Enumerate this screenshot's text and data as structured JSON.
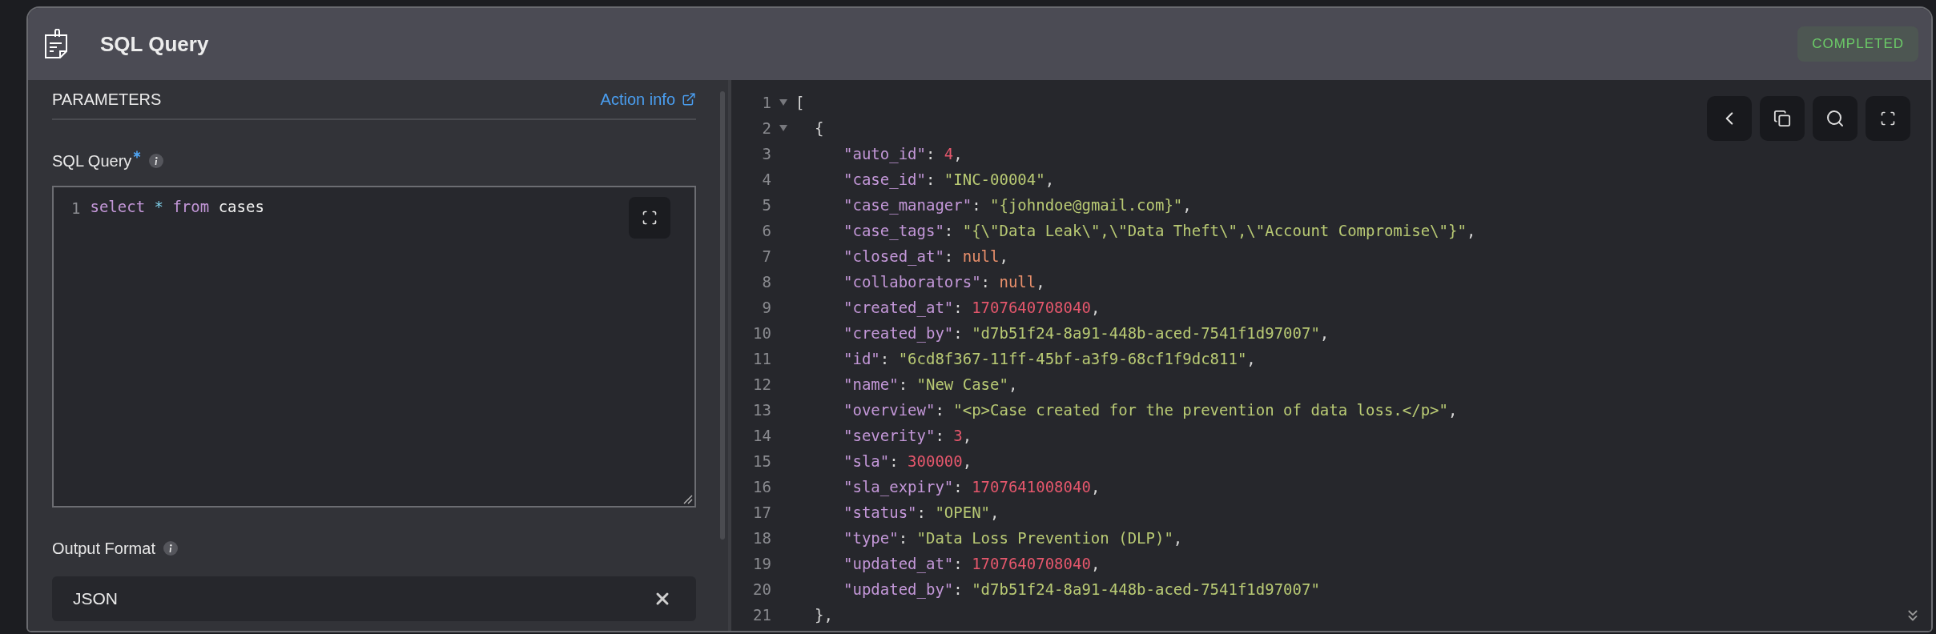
{
  "header": {
    "title": "SQL Query",
    "status": "COMPLETED"
  },
  "parameters": {
    "heading": "PARAMETERS",
    "action_link": "Action info",
    "fields": [
      {
        "kind": "code",
        "label": "SQL Query",
        "required": true,
        "line_number": "1",
        "tokens": [
          {
            "kind": "keyword",
            "text": "select"
          },
          {
            "kind": "operator",
            "text": "*"
          },
          {
            "kind": "keyword",
            "text": "from"
          },
          {
            "kind": "plain",
            "text": "cases"
          }
        ]
      },
      {
        "kind": "select",
        "label": "Output Format",
        "value": "JSON"
      }
    ]
  },
  "output": {
    "lines": [
      {
        "number": "1",
        "foldable": true,
        "tokens": [
          {
            "kind": "punct",
            "text": "["
          }
        ],
        "children": [
          {
            "number": "2",
            "foldable": true,
            "tokens": [
              {
                "kind": "punct",
                "text": "{"
              }
            ],
            "children": [
              {
                "number": "3",
                "tokens": [
                  {
                    "kind": "key",
                    "text": "\"auto_id\""
                  },
                  {
                    "kind": "punct",
                    "text": ": "
                  },
                  {
                    "kind": "number",
                    "text": "4"
                  },
                  {
                    "kind": "punct",
                    "text": ","
                  }
                ]
              },
              {
                "number": "4",
                "tokens": [
                  {
                    "kind": "key",
                    "text": "\"case_id\""
                  },
                  {
                    "kind": "punct",
                    "text": ": "
                  },
                  {
                    "kind": "string",
                    "text": "\"INC-00004\""
                  },
                  {
                    "kind": "punct",
                    "text": ","
                  }
                ]
              },
              {
                "number": "5",
                "tokens": [
                  {
                    "kind": "key",
                    "text": "\"case_manager\""
                  },
                  {
                    "kind": "punct",
                    "text": ": "
                  },
                  {
                    "kind": "string",
                    "text": "\"{johndoe@gmail.com}\""
                  },
                  {
                    "kind": "punct",
                    "text": ","
                  }
                ]
              },
              {
                "number": "6",
                "tokens": [
                  {
                    "kind": "key",
                    "text": "\"case_tags\""
                  },
                  {
                    "kind": "punct",
                    "text": ": "
                  },
                  {
                    "kind": "string",
                    "text": "\"{\\\"Data Leak\\\",\\\"Data Theft\\\",\\\"Account Compromise\\\"}\""
                  },
                  {
                    "kind": "punct",
                    "text": ","
                  }
                ]
              },
              {
                "number": "7",
                "tokens": [
                  {
                    "kind": "key",
                    "text": "\"closed_at\""
                  },
                  {
                    "kind": "punct",
                    "text": ": "
                  },
                  {
                    "kind": "null",
                    "text": "null"
                  },
                  {
                    "kind": "punct",
                    "text": ","
                  }
                ]
              },
              {
                "number": "8",
                "tokens": [
                  {
                    "kind": "key",
                    "text": "\"collaborators\""
                  },
                  {
                    "kind": "punct",
                    "text": ": "
                  },
                  {
                    "kind": "null",
                    "text": "null"
                  },
                  {
                    "kind": "punct",
                    "text": ","
                  }
                ]
              },
              {
                "number": "9",
                "tokens": [
                  {
                    "kind": "key",
                    "text": "\"created_at\""
                  },
                  {
                    "kind": "punct",
                    "text": ": "
                  },
                  {
                    "kind": "number",
                    "text": "1707640708040"
                  },
                  {
                    "kind": "punct",
                    "text": ","
                  }
                ]
              },
              {
                "number": "10",
                "tokens": [
                  {
                    "kind": "key",
                    "text": "\"created_by\""
                  },
                  {
                    "kind": "punct",
                    "text": ": "
                  },
                  {
                    "kind": "string",
                    "text": "\"d7b51f24-8a91-448b-aced-7541f1d97007\""
                  },
                  {
                    "kind": "punct",
                    "text": ","
                  }
                ]
              },
              {
                "number": "11",
                "tokens": [
                  {
                    "kind": "key",
                    "text": "\"id\""
                  },
                  {
                    "kind": "punct",
                    "text": ": "
                  },
                  {
                    "kind": "string",
                    "text": "\"6cd8f367-11ff-45bf-a3f9-68cf1f9dc811\""
                  },
                  {
                    "kind": "punct",
                    "text": ","
                  }
                ]
              },
              {
                "number": "12",
                "tokens": [
                  {
                    "kind": "key",
                    "text": "\"name\""
                  },
                  {
                    "kind": "punct",
                    "text": ": "
                  },
                  {
                    "kind": "string",
                    "text": "\"New Case\""
                  },
                  {
                    "kind": "punct",
                    "text": ","
                  }
                ]
              },
              {
                "number": "13",
                "tokens": [
                  {
                    "kind": "key",
                    "text": "\"overview\""
                  },
                  {
                    "kind": "punct",
                    "text": ": "
                  },
                  {
                    "kind": "string",
                    "text": "\"<p>Case created for the prevention of data loss.</p>\""
                  },
                  {
                    "kind": "punct",
                    "text": ","
                  }
                ]
              },
              {
                "number": "14",
                "tokens": [
                  {
                    "kind": "key",
                    "text": "\"severity\""
                  },
                  {
                    "kind": "punct",
                    "text": ": "
                  },
                  {
                    "kind": "number",
                    "text": "3"
                  },
                  {
                    "kind": "punct",
                    "text": ","
                  }
                ]
              },
              {
                "number": "15",
                "tokens": [
                  {
                    "kind": "key",
                    "text": "\"sla\""
                  },
                  {
                    "kind": "punct",
                    "text": ": "
                  },
                  {
                    "kind": "number",
                    "text": "300000"
                  },
                  {
                    "kind": "punct",
                    "text": ","
                  }
                ]
              },
              {
                "number": "16",
                "tokens": [
                  {
                    "kind": "key",
                    "text": "\"sla_expiry\""
                  },
                  {
                    "kind": "punct",
                    "text": ": "
                  },
                  {
                    "kind": "number",
                    "text": "1707641008040"
                  },
                  {
                    "kind": "punct",
                    "text": ","
                  }
                ]
              },
              {
                "number": "17",
                "tokens": [
                  {
                    "kind": "key",
                    "text": "\"status\""
                  },
                  {
                    "kind": "punct",
                    "text": ": "
                  },
                  {
                    "kind": "string",
                    "text": "\"OPEN\""
                  },
                  {
                    "kind": "punct",
                    "text": ","
                  }
                ]
              },
              {
                "number": "18",
                "tokens": [
                  {
                    "kind": "key",
                    "text": "\"type\""
                  },
                  {
                    "kind": "punct",
                    "text": ": "
                  },
                  {
                    "kind": "string",
                    "text": "\"Data Loss Prevention (DLP)\""
                  },
                  {
                    "kind": "punct",
                    "text": ","
                  }
                ]
              },
              {
                "number": "19",
                "tokens": [
                  {
                    "kind": "key",
                    "text": "\"updated_at\""
                  },
                  {
                    "kind": "punct",
                    "text": ": "
                  },
                  {
                    "kind": "number",
                    "text": "1707640708040"
                  },
                  {
                    "kind": "punct",
                    "text": ","
                  }
                ]
              },
              {
                "number": "20",
                "tokens": [
                  {
                    "kind": "key",
                    "text": "\"updated_by\""
                  },
                  {
                    "kind": "punct",
                    "text": ": "
                  },
                  {
                    "kind": "string",
                    "text": "\"d7b51f24-8a91-448b-aced-7541f1d97007\""
                  }
                ]
              }
            ]
          },
          {
            "number": "21",
            "tokens": [
              {
                "kind": "punct",
                "text": "},"
              }
            ]
          }
        ]
      }
    ]
  }
}
